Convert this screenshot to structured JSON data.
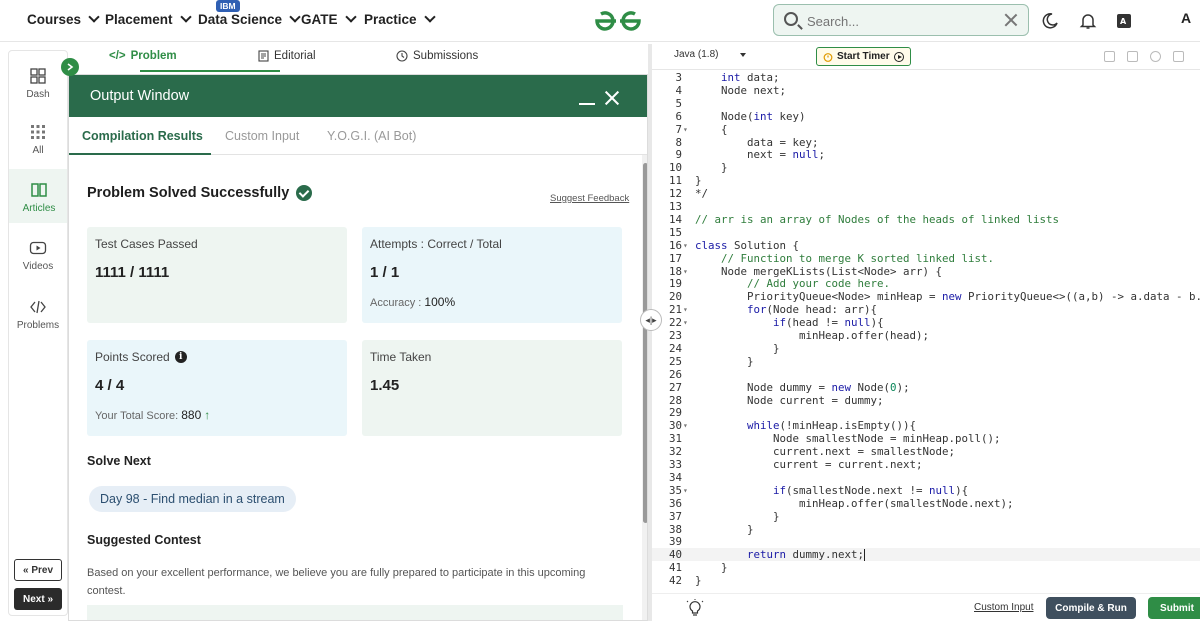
{
  "nav": {
    "items": [
      {
        "label": "Courses"
      },
      {
        "label": "Placement"
      },
      {
        "label": "Data Science"
      },
      {
        "label": "GATE"
      },
      {
        "label": "Practice"
      }
    ],
    "ibm_badge": "IBM",
    "search_placeholder": "Search...",
    "avatar_initial": "A"
  },
  "rail": {
    "items": [
      {
        "label": "Dash",
        "icon": "dashboard-icon"
      },
      {
        "label": "All",
        "icon": "grid-icon"
      },
      {
        "label": "Articles",
        "icon": "book-icon"
      },
      {
        "label": "Videos",
        "icon": "video-icon"
      },
      {
        "label": "Problems",
        "icon": "code-icon"
      }
    ],
    "prev_label": "« Prev",
    "next_label": "Next »"
  },
  "problem_tabs": [
    {
      "label": "Problem"
    },
    {
      "label": "Editorial"
    },
    {
      "label": "Submissions"
    }
  ],
  "output_window": {
    "title": "Output Window",
    "tabs": [
      "Compilation Results",
      "Custom Input",
      "Y.O.G.I. (AI Bot)"
    ],
    "status": "Problem Solved Successfully",
    "suggest_feedback": "Suggest Feedback",
    "cards": {
      "test_cases": {
        "label": "Test Cases Passed",
        "value": "1111 / 1111"
      },
      "attempts": {
        "label": "Attempts : Correct / Total",
        "value": "1 / 1",
        "sub_label": "Accuracy :",
        "sub_value": "100%"
      },
      "points": {
        "label": "Points Scored",
        "value": "4 / 4",
        "sub_label": "Your Total Score:",
        "sub_value": "880"
      },
      "time": {
        "label": "Time Taken",
        "value": "1.45"
      }
    },
    "solve_next_heading": "Solve Next",
    "solve_next_item": "Day 98 - Find median in a stream",
    "contest_heading": "Suggested Contest",
    "contest_text": "Based on your excellent performance, we believe you are fully prepared to participate in this upcoming contest."
  },
  "editor": {
    "language": "Java (1.8)",
    "timer_label": "Start Timer",
    "custom_input": "Custom Input",
    "compile_run": "Compile & Run",
    "submit": "Submit",
    "lines": [
      {
        "n": "3",
        "fold": "",
        "html": "    <span class='kw'>int</span> data;"
      },
      {
        "n": "4",
        "fold": "",
        "html": "    Node next;"
      },
      {
        "n": "5",
        "fold": "",
        "html": ""
      },
      {
        "n": "6",
        "fold": "",
        "html": "    Node(<span class='kw'>int</span> key)"
      },
      {
        "n": "7",
        "fold": "▾",
        "html": "    {"
      },
      {
        "n": "8",
        "fold": "",
        "html": "        data = key;"
      },
      {
        "n": "9",
        "fold": "",
        "html": "        next = <span class='kw'>null</span>;"
      },
      {
        "n": "10",
        "fold": "",
        "html": "    }"
      },
      {
        "n": "11",
        "fold": "",
        "html": "}"
      },
      {
        "n": "12",
        "fold": "",
        "html": "*/"
      },
      {
        "n": "13",
        "fold": "",
        "html": ""
      },
      {
        "n": "14",
        "fold": "",
        "html": "<span class='cm'>// arr is an array of Nodes of the heads of linked lists</span>"
      },
      {
        "n": "15",
        "fold": "",
        "html": ""
      },
      {
        "n": "16",
        "fold": "▾",
        "html": "<span class='kw'>class</span> Solution {"
      },
      {
        "n": "17",
        "fold": "",
        "html": "    <span class='cm'>// Function to merge K sorted linked list.</span>"
      },
      {
        "n": "18",
        "fold": "▾",
        "html": "    Node mergeKLists(List&lt;Node&gt; arr) {"
      },
      {
        "n": "19",
        "fold": "",
        "html": "        <span class='cm'>// Add your code here.</span>"
      },
      {
        "n": "20",
        "fold": "",
        "html": "        PriorityQueue&lt;Node&gt; minHeap = <span class='kw'>new</span> PriorityQueue&lt;&gt;((a,b) -&gt; a.data - b.data);"
      },
      {
        "n": "21",
        "fold": "▾",
        "html": "        <span class='kw'>for</span>(Node head: arr){"
      },
      {
        "n": "22",
        "fold": "▾",
        "html": "            <span class='kw'>if</span>(head != <span class='kw'>null</span>){"
      },
      {
        "n": "23",
        "fold": "",
        "html": "                minHeap.offer(head);"
      },
      {
        "n": "24",
        "fold": "",
        "html": "            }"
      },
      {
        "n": "25",
        "fold": "",
        "html": "        }"
      },
      {
        "n": "26",
        "fold": "",
        "html": ""
      },
      {
        "n": "27",
        "fold": "",
        "html": "        Node dummy = <span class='kw'>new</span> Node(<span class='nm'>0</span>);"
      },
      {
        "n": "28",
        "fold": "",
        "html": "        Node current = dummy;"
      },
      {
        "n": "29",
        "fold": "",
        "html": ""
      },
      {
        "n": "30",
        "fold": "▾",
        "html": "        <span class='kw'>while</span>(!minHeap.isEmpty()){"
      },
      {
        "n": "31",
        "fold": "",
        "html": "            Node smallestNode = minHeap.poll();"
      },
      {
        "n": "32",
        "fold": "",
        "html": "            current.next = smallestNode;"
      },
      {
        "n": "33",
        "fold": "",
        "html": "            current = current.next;"
      },
      {
        "n": "34",
        "fold": "",
        "html": ""
      },
      {
        "n": "35",
        "fold": "▾",
        "html": "            <span class='kw'>if</span>(smallestNode.next != <span class='kw'>null</span>){"
      },
      {
        "n": "36",
        "fold": "",
        "html": "                minHeap.offer(smallestNode.next);"
      },
      {
        "n": "37",
        "fold": "",
        "html": "            }"
      },
      {
        "n": "38",
        "fold": "",
        "html": "        }"
      },
      {
        "n": "39",
        "fold": "",
        "html": ""
      },
      {
        "n": "40",
        "fold": "",
        "html": "        <span class='kw'>return</span> dummy.next;<span class='cursor-bar'></span>",
        "highlight": true
      },
      {
        "n": "41",
        "fold": "",
        "html": "    }"
      },
      {
        "n": "42",
        "fold": "",
        "html": "}"
      }
    ]
  },
  "colors": {
    "brand_green": "#2f8d46",
    "window_header": "#2a6b4b",
    "keyword": "#1a1aa6",
    "comment": "#2f7d3c"
  }
}
